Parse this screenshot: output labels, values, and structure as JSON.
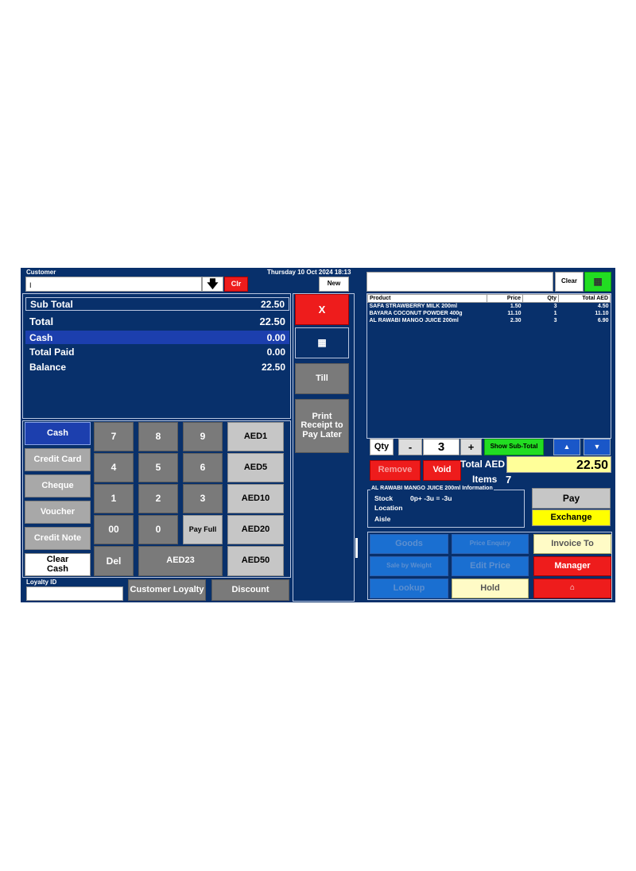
{
  "header": {
    "customer_label": "Customer",
    "customer_value": "I",
    "clr_label": "Clr",
    "datetime": "Thursday 10 Oct 2024 18:13",
    "new_label": "New"
  },
  "summary": {
    "subtotal_label": "Sub Total",
    "subtotal_value": "22.50",
    "total_label": "Total",
    "total_value": "22.50",
    "cash_label": "Cash",
    "cash_value": "0.00",
    "total_paid_label": "Total Paid",
    "total_paid_value": "0.00",
    "balance_label": "Balance",
    "balance_value": "22.50"
  },
  "side_actions": {
    "cancel_label": "X",
    "till_label": "Till",
    "print_later_label": "Print Receipt to Pay Later"
  },
  "payment_methods": [
    "Cash",
    "Credit Card",
    "Cheque",
    "Voucher",
    "Credit Note",
    "Clear Cash"
  ],
  "keypad": {
    "keys": [
      "7",
      "8",
      "9",
      "4",
      "5",
      "6",
      "1",
      "2",
      "3",
      "00",
      "0"
    ],
    "pay_full": "Pay Full",
    "del": "Del",
    "aed23": "AED23",
    "quick_amounts": [
      "AED1",
      "AED5",
      "AED10",
      "AED20",
      "AED50"
    ]
  },
  "footer_left": {
    "loyalty_label": "Loyalty ID",
    "customer_loyalty": "Customer Loyalty",
    "discount": "Discount"
  },
  "search": {
    "clear_label": "Clear"
  },
  "items_table": {
    "columns": [
      "Product",
      "Price",
      "Qty",
      "Total AED"
    ],
    "rows": [
      [
        "SAFA STRAWBERRY MILK 200ml",
        "1.50",
        "3",
        "4.50"
      ],
      [
        "BAYARA COCONUT POWDER 400g",
        "11.10",
        "1",
        "11.10"
      ],
      [
        "AL RAWABI MANGO JUICE 200ml",
        "2.30",
        "3",
        "6.90"
      ]
    ]
  },
  "qty_bar": {
    "qty_label": "Qty",
    "minus": "-",
    "value": "3",
    "plus": "+",
    "show_subtotal": "Show Sub-Total"
  },
  "totals": {
    "remove": "Remove",
    "void": "Void",
    "total_label": "Total AED",
    "total_value": "22.50",
    "items_label": "Items",
    "items_value": "7"
  },
  "info": {
    "title": "AL RAWABI MANGO JUICE 200ml Information",
    "stock_label": "Stock",
    "stock_value": "0p+ -3u = -3u",
    "location_label": "Location",
    "aisle_label": "Aisle"
  },
  "right_actions": {
    "pay": "Pay",
    "exchange": "Exchange"
  },
  "bottom_grid": {
    "goods": "Goods",
    "price_enquiry": "Price Enquiry",
    "invoice_to": "Invoice To",
    "sale_by_weight": "Sale by Weight",
    "edit_price": "Edit Price",
    "manager": "Manager",
    "lookup": "Lookup",
    "hold": "Hold"
  },
  "colors": {
    "background": "#08306b",
    "red": "#ee1c1c",
    "green": "#22dd22",
    "yellow": "#ffff00"
  }
}
